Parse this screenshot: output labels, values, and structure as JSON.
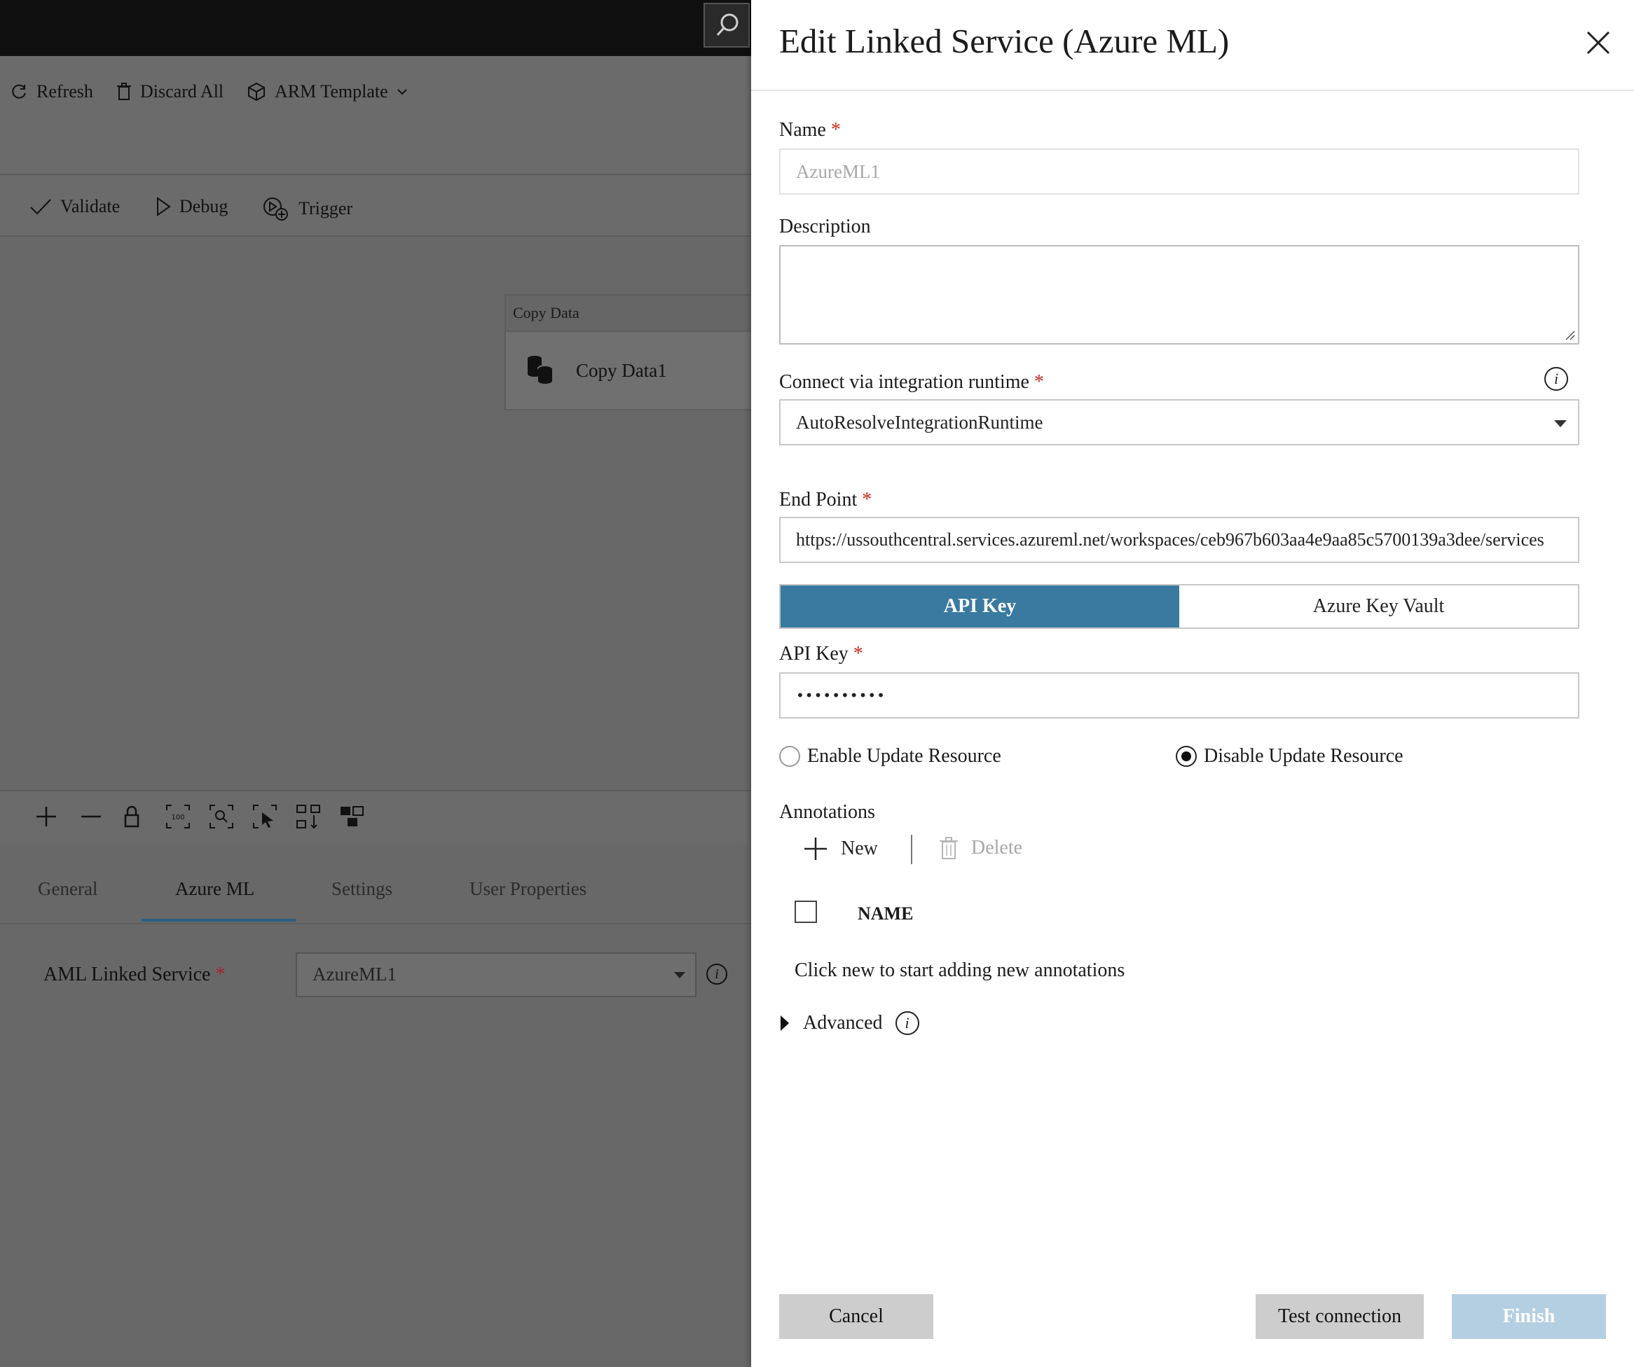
{
  "background": {
    "toolbar": {
      "refresh_label": "Refresh",
      "discard_label": "Discard All",
      "arm_label": "ARM Template"
    },
    "pipeline_toolbar": {
      "validate_label": "Validate",
      "debug_label": "Debug",
      "trigger_label": "Trigger"
    },
    "activity": {
      "type_label": "Copy Data",
      "name": "Copy Data1"
    },
    "canvas_tools": [
      "zoom-in-icon",
      "zoom-out-icon",
      "lock-icon",
      "zoom-100-icon",
      "zoom-fit-icon",
      "select-icon",
      "auto-align-icon",
      "layout-icon"
    ],
    "tabs": [
      {
        "label": "General"
      },
      {
        "label": "Azure ML"
      },
      {
        "label": "Settings"
      },
      {
        "label": "User Properties"
      }
    ],
    "active_tab": "Azure ML",
    "aml": {
      "label": "AML Linked Service",
      "required_mark": "*",
      "value": "AzureML1"
    }
  },
  "dialog": {
    "title": "Edit Linked Service (Azure ML)",
    "required_mark": "*",
    "name": {
      "label": "Name",
      "value": "AzureML1"
    },
    "description": {
      "label": "Description",
      "value": ""
    },
    "runtime": {
      "label": "Connect via integration runtime",
      "value": "AutoResolveIntegrationRuntime"
    },
    "endpoint": {
      "label": "End Point",
      "value": "https://ussouthcentral.services.azureml.net/workspaces/ceb967b603aa4e9aa85c5700139a3dee/services"
    },
    "auth_tabs": {
      "api_key": "API Key",
      "key_vault": "Azure Key Vault",
      "selected": "API Key"
    },
    "api_key": {
      "label": "API Key",
      "value": "••••••••••"
    },
    "update_resource": {
      "enable_label": "Enable Update Resource",
      "disable_label": "Disable Update Resource",
      "selected": "Disable Update Resource"
    },
    "annotations": {
      "label": "Annotations",
      "new_label": "New",
      "delete_label": "Delete",
      "column_name": "NAME",
      "empty_text": "Click new to start adding new annotations"
    },
    "advanced_label": "Advanced",
    "buttons": {
      "cancel": "Cancel",
      "test": "Test connection",
      "finish": "Finish"
    }
  },
  "colors": {
    "accent": "#3a7aa0",
    "finish_disabled": "#b4cfe1",
    "required": "#c42b1c",
    "overlay": "#6a6a6a"
  }
}
